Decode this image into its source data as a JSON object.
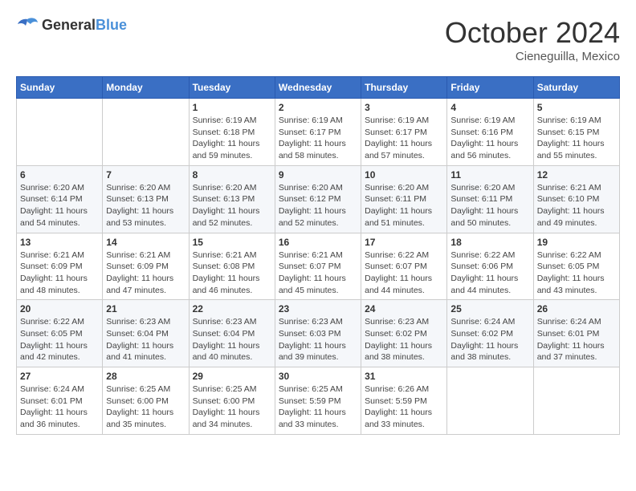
{
  "header": {
    "logo_general": "General",
    "logo_blue": "Blue",
    "month": "October 2024",
    "location": "Cieneguilla, Mexico"
  },
  "weekdays": [
    "Sunday",
    "Monday",
    "Tuesday",
    "Wednesday",
    "Thursday",
    "Friday",
    "Saturday"
  ],
  "weeks": [
    [
      {
        "day": "",
        "sunrise": "",
        "sunset": "",
        "daylight": ""
      },
      {
        "day": "",
        "sunrise": "",
        "sunset": "",
        "daylight": ""
      },
      {
        "day": "1",
        "sunrise": "Sunrise: 6:19 AM",
        "sunset": "Sunset: 6:18 PM",
        "daylight": "Daylight: 11 hours and 59 minutes."
      },
      {
        "day": "2",
        "sunrise": "Sunrise: 6:19 AM",
        "sunset": "Sunset: 6:17 PM",
        "daylight": "Daylight: 11 hours and 58 minutes."
      },
      {
        "day": "3",
        "sunrise": "Sunrise: 6:19 AM",
        "sunset": "Sunset: 6:17 PM",
        "daylight": "Daylight: 11 hours and 57 minutes."
      },
      {
        "day": "4",
        "sunrise": "Sunrise: 6:19 AM",
        "sunset": "Sunset: 6:16 PM",
        "daylight": "Daylight: 11 hours and 56 minutes."
      },
      {
        "day": "5",
        "sunrise": "Sunrise: 6:19 AM",
        "sunset": "Sunset: 6:15 PM",
        "daylight": "Daylight: 11 hours and 55 minutes."
      }
    ],
    [
      {
        "day": "6",
        "sunrise": "Sunrise: 6:20 AM",
        "sunset": "Sunset: 6:14 PM",
        "daylight": "Daylight: 11 hours and 54 minutes."
      },
      {
        "day": "7",
        "sunrise": "Sunrise: 6:20 AM",
        "sunset": "Sunset: 6:13 PM",
        "daylight": "Daylight: 11 hours and 53 minutes."
      },
      {
        "day": "8",
        "sunrise": "Sunrise: 6:20 AM",
        "sunset": "Sunset: 6:13 PM",
        "daylight": "Daylight: 11 hours and 52 minutes."
      },
      {
        "day": "9",
        "sunrise": "Sunrise: 6:20 AM",
        "sunset": "Sunset: 6:12 PM",
        "daylight": "Daylight: 11 hours and 52 minutes."
      },
      {
        "day": "10",
        "sunrise": "Sunrise: 6:20 AM",
        "sunset": "Sunset: 6:11 PM",
        "daylight": "Daylight: 11 hours and 51 minutes."
      },
      {
        "day": "11",
        "sunrise": "Sunrise: 6:20 AM",
        "sunset": "Sunset: 6:11 PM",
        "daylight": "Daylight: 11 hours and 50 minutes."
      },
      {
        "day": "12",
        "sunrise": "Sunrise: 6:21 AM",
        "sunset": "Sunset: 6:10 PM",
        "daylight": "Daylight: 11 hours and 49 minutes."
      }
    ],
    [
      {
        "day": "13",
        "sunrise": "Sunrise: 6:21 AM",
        "sunset": "Sunset: 6:09 PM",
        "daylight": "Daylight: 11 hours and 48 minutes."
      },
      {
        "day": "14",
        "sunrise": "Sunrise: 6:21 AM",
        "sunset": "Sunset: 6:09 PM",
        "daylight": "Daylight: 11 hours and 47 minutes."
      },
      {
        "day": "15",
        "sunrise": "Sunrise: 6:21 AM",
        "sunset": "Sunset: 6:08 PM",
        "daylight": "Daylight: 11 hours and 46 minutes."
      },
      {
        "day": "16",
        "sunrise": "Sunrise: 6:21 AM",
        "sunset": "Sunset: 6:07 PM",
        "daylight": "Daylight: 11 hours and 45 minutes."
      },
      {
        "day": "17",
        "sunrise": "Sunrise: 6:22 AM",
        "sunset": "Sunset: 6:07 PM",
        "daylight": "Daylight: 11 hours and 44 minutes."
      },
      {
        "day": "18",
        "sunrise": "Sunrise: 6:22 AM",
        "sunset": "Sunset: 6:06 PM",
        "daylight": "Daylight: 11 hours and 44 minutes."
      },
      {
        "day": "19",
        "sunrise": "Sunrise: 6:22 AM",
        "sunset": "Sunset: 6:05 PM",
        "daylight": "Daylight: 11 hours and 43 minutes."
      }
    ],
    [
      {
        "day": "20",
        "sunrise": "Sunrise: 6:22 AM",
        "sunset": "Sunset: 6:05 PM",
        "daylight": "Daylight: 11 hours and 42 minutes."
      },
      {
        "day": "21",
        "sunrise": "Sunrise: 6:23 AM",
        "sunset": "Sunset: 6:04 PM",
        "daylight": "Daylight: 11 hours and 41 minutes."
      },
      {
        "day": "22",
        "sunrise": "Sunrise: 6:23 AM",
        "sunset": "Sunset: 6:04 PM",
        "daylight": "Daylight: 11 hours and 40 minutes."
      },
      {
        "day": "23",
        "sunrise": "Sunrise: 6:23 AM",
        "sunset": "Sunset: 6:03 PM",
        "daylight": "Daylight: 11 hours and 39 minutes."
      },
      {
        "day": "24",
        "sunrise": "Sunrise: 6:23 AM",
        "sunset": "Sunset: 6:02 PM",
        "daylight": "Daylight: 11 hours and 38 minutes."
      },
      {
        "day": "25",
        "sunrise": "Sunrise: 6:24 AM",
        "sunset": "Sunset: 6:02 PM",
        "daylight": "Daylight: 11 hours and 38 minutes."
      },
      {
        "day": "26",
        "sunrise": "Sunrise: 6:24 AM",
        "sunset": "Sunset: 6:01 PM",
        "daylight": "Daylight: 11 hours and 37 minutes."
      }
    ],
    [
      {
        "day": "27",
        "sunrise": "Sunrise: 6:24 AM",
        "sunset": "Sunset: 6:01 PM",
        "daylight": "Daylight: 11 hours and 36 minutes."
      },
      {
        "day": "28",
        "sunrise": "Sunrise: 6:25 AM",
        "sunset": "Sunset: 6:00 PM",
        "daylight": "Daylight: 11 hours and 35 minutes."
      },
      {
        "day": "29",
        "sunrise": "Sunrise: 6:25 AM",
        "sunset": "Sunset: 6:00 PM",
        "daylight": "Daylight: 11 hours and 34 minutes."
      },
      {
        "day": "30",
        "sunrise": "Sunrise: 6:25 AM",
        "sunset": "Sunset: 5:59 PM",
        "daylight": "Daylight: 11 hours and 33 minutes."
      },
      {
        "day": "31",
        "sunrise": "Sunrise: 6:26 AM",
        "sunset": "Sunset: 5:59 PM",
        "daylight": "Daylight: 11 hours and 33 minutes."
      },
      {
        "day": "",
        "sunrise": "",
        "sunset": "",
        "daylight": ""
      },
      {
        "day": "",
        "sunrise": "",
        "sunset": "",
        "daylight": ""
      }
    ]
  ]
}
